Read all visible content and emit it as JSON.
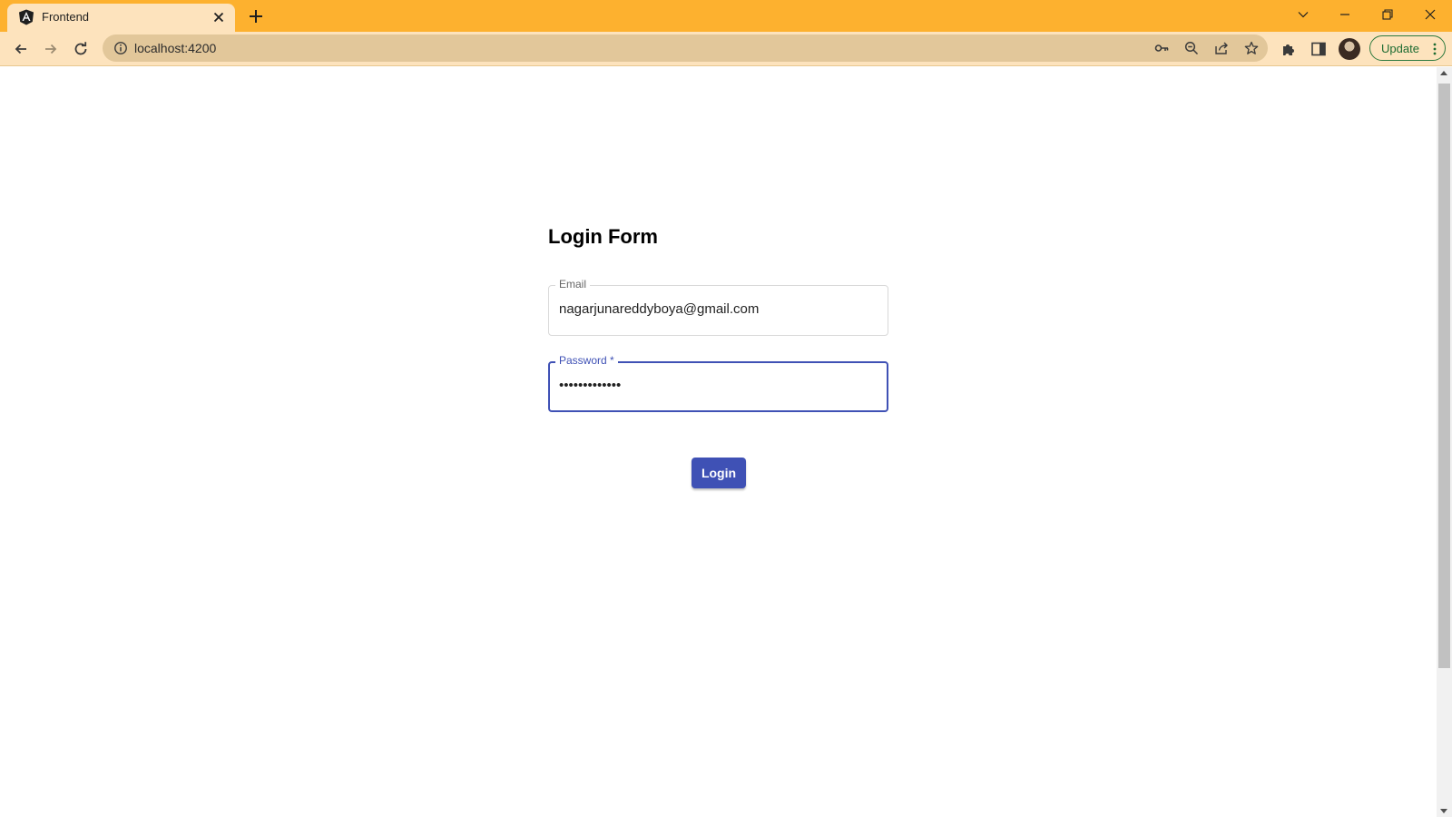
{
  "browser": {
    "tab": {
      "title": "Frontend",
      "favicon": "angular-icon"
    },
    "address": {
      "url": "localhost:4200"
    },
    "toolbar": {
      "update_label": "Update"
    },
    "colors": {
      "frame": "#fdb12f",
      "toolbar": "#fde3bd",
      "accent": "#3f51b5"
    }
  },
  "page": {
    "title": "Login Form",
    "email": {
      "label": "Email",
      "value": "nagarjunareddyboya@gmail.com"
    },
    "password": {
      "label": "Password",
      "required_mark": "*",
      "value": "•••••••••••••"
    },
    "login_label": "Login"
  }
}
